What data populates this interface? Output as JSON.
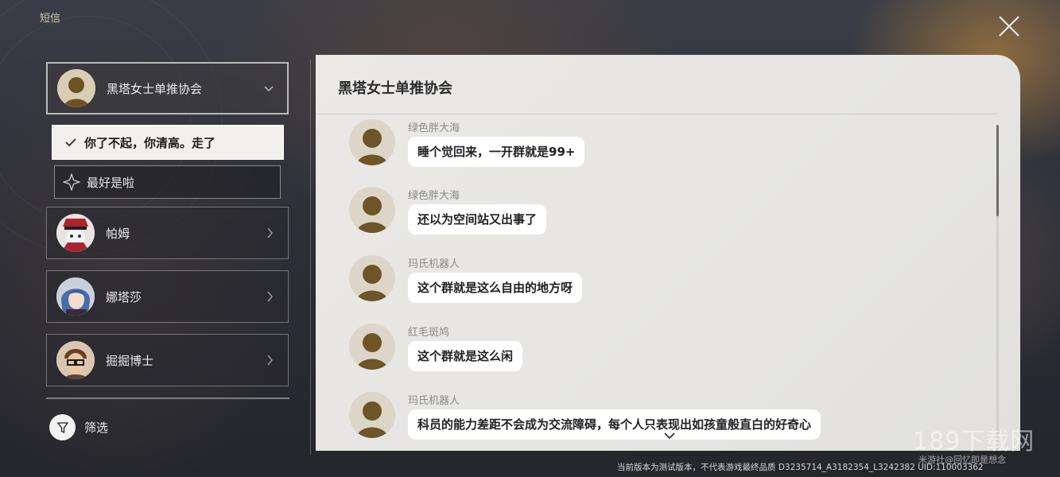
{
  "app": {
    "title": "短信"
  },
  "sidebar": {
    "contacts": [
      {
        "name": "黑塔女士单推协会",
        "avatar": "group-silhouette",
        "expanded": true
      },
      {
        "name": "帕姆",
        "avatar": "pom-pom-portrait"
      },
      {
        "name": "娜塔莎",
        "avatar": "natasha-portrait"
      },
      {
        "name": "掘掘博士",
        "avatar": "dr-digger-portrait"
      }
    ],
    "reply_options": {
      "selected": "你了不起，你清高。走了",
      "pending": "最好是啦"
    },
    "filter_label": "筛选"
  },
  "chat": {
    "title": "黑塔女士单推协会",
    "messages": [
      {
        "sender": "绿色胖大海",
        "text": "睡个觉回来，一开群就是99+"
      },
      {
        "sender": "绿色胖大海",
        "text": "还以为空间站又出事了"
      },
      {
        "sender": "玛氏机器人",
        "text": "这个群就是这么自由的地方呀"
      },
      {
        "sender": "红毛斑鸠",
        "text": "这个群就是这么闲"
      },
      {
        "sender": "玛氏机器人",
        "text": "科员的能力差距不会成为交流障碍，每个人只表现出如孩童般直白的好奇心"
      }
    ]
  },
  "footer": {
    "version_text": "当前版本为测试版本，不代表游戏最终品质  D3235714_A3182354_L3242382  UID:110003362"
  },
  "watermark": {
    "main": "189下载网",
    "sub": "米游社@回忆即是想念"
  },
  "colors": {
    "panel_bg": "#e8e7e4",
    "bubble_bg": "#ffffff",
    "selected_option_bg": "#f1f0ec",
    "sender_text": "#8a8985"
  },
  "icons": [
    "close-icon",
    "chevron-down-icon",
    "chevron-right-icon",
    "checkmark-icon",
    "diamond-star-icon",
    "filter-funnel-icon",
    "scroll-more-icon"
  ]
}
